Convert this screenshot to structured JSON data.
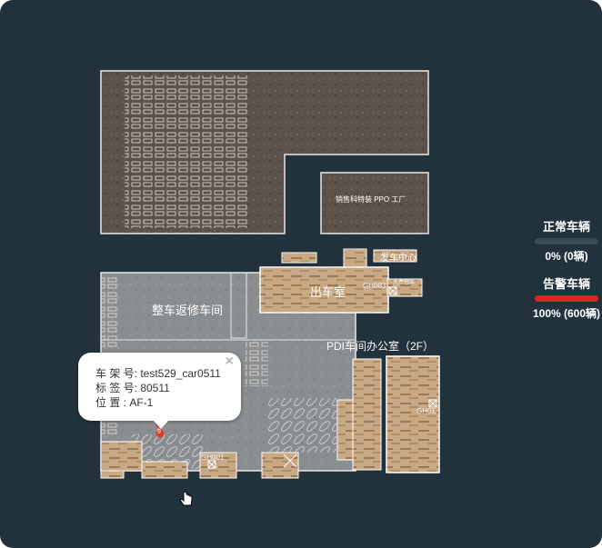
{
  "map": {
    "rooms": {
      "sales_factory": "销售科特装 PPO 工厂",
      "car_center": "发车中心",
      "exit_room": "出车室",
      "repair_shop": "整车返修车间",
      "pdi_office": "PDI车间办公室（2F）",
      "small_label": "大件仓库"
    },
    "gates": {
      "gate_a": "GH003",
      "gate_b": "GH01",
      "gate_c": "GH001"
    },
    "marker_label": "9"
  },
  "legend": {
    "normal_title": "正常车辆",
    "normal_value": "0% (0辆)",
    "alarm_title": "告警车辆",
    "alarm_value": "100% (600辆)",
    "normal_color": "#3a4a55",
    "alarm_color": "#e0231c"
  },
  "tooltip": {
    "frame_line": "车 架 号: test529_car0511",
    "tag_line": "标 签 号: 80511",
    "position_line": "位 置 : AF-1",
    "close_label": "×"
  },
  "cursor_icon": "hand-pointer-icon"
}
